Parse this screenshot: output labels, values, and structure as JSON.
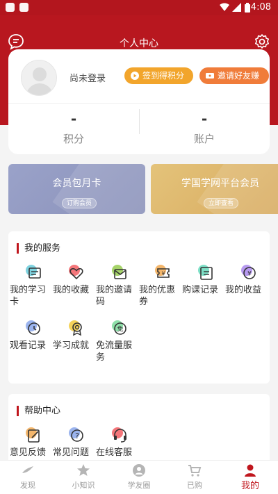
{
  "status_bar": {
    "time": "4:08"
  },
  "header": {
    "title": "个人中心",
    "message_icon": "message-icon",
    "settings_icon": "gear-icon"
  },
  "profile": {
    "login_status": "尚未登录",
    "sign_in_button": "签到得积分",
    "invite_button": "邀请好友赚",
    "points_value": "-",
    "points_label": "积分",
    "account_value": "-",
    "account_label": "账户"
  },
  "banners": [
    {
      "title": "会员包月卡",
      "button": "订购会员",
      "color": "#9aa2c9"
    },
    {
      "title": "学国学网平台会员",
      "button": "立即查看",
      "color": "#ddb66c"
    }
  ],
  "services": {
    "title": "我的服务",
    "items": [
      {
        "label": "我的学习卡",
        "icon": "study-card-icon"
      },
      {
        "label": "我的收藏",
        "icon": "heart-icon"
      },
      {
        "label": "我的邀请码",
        "icon": "invite-code-icon"
      },
      {
        "label": "我的优惠券",
        "icon": "coupon-icon"
      },
      {
        "label": "购课记录",
        "icon": "purchase-record-icon"
      },
      {
        "label": "我的收益",
        "icon": "earnings-icon"
      },
      {
        "label": "观看记录",
        "icon": "clock-icon"
      },
      {
        "label": "学习成就",
        "icon": "medal-icon"
      },
      {
        "label": "免流量服务",
        "icon": "free-data-icon"
      }
    ]
  },
  "help": {
    "title": "帮助中心",
    "items": [
      {
        "label": "意见反馈",
        "icon": "feedback-icon"
      },
      {
        "label": "常见问题",
        "icon": "question-icon"
      },
      {
        "label": "在线客服",
        "icon": "customer-service-icon"
      }
    ]
  },
  "tabbar": {
    "items": [
      {
        "label": "发现",
        "icon": "discover-icon"
      },
      {
        "label": "小知识",
        "icon": "star-icon"
      },
      {
        "label": "学友圈",
        "icon": "friends-icon"
      },
      {
        "label": "已购",
        "icon": "cart-icon"
      },
      {
        "label": "我的",
        "icon": "user-icon"
      }
    ],
    "active_index": 4
  },
  "colors": {
    "brand": "#b8171f",
    "sign_in": "#f2a52c",
    "invite": "#f07c3a"
  }
}
